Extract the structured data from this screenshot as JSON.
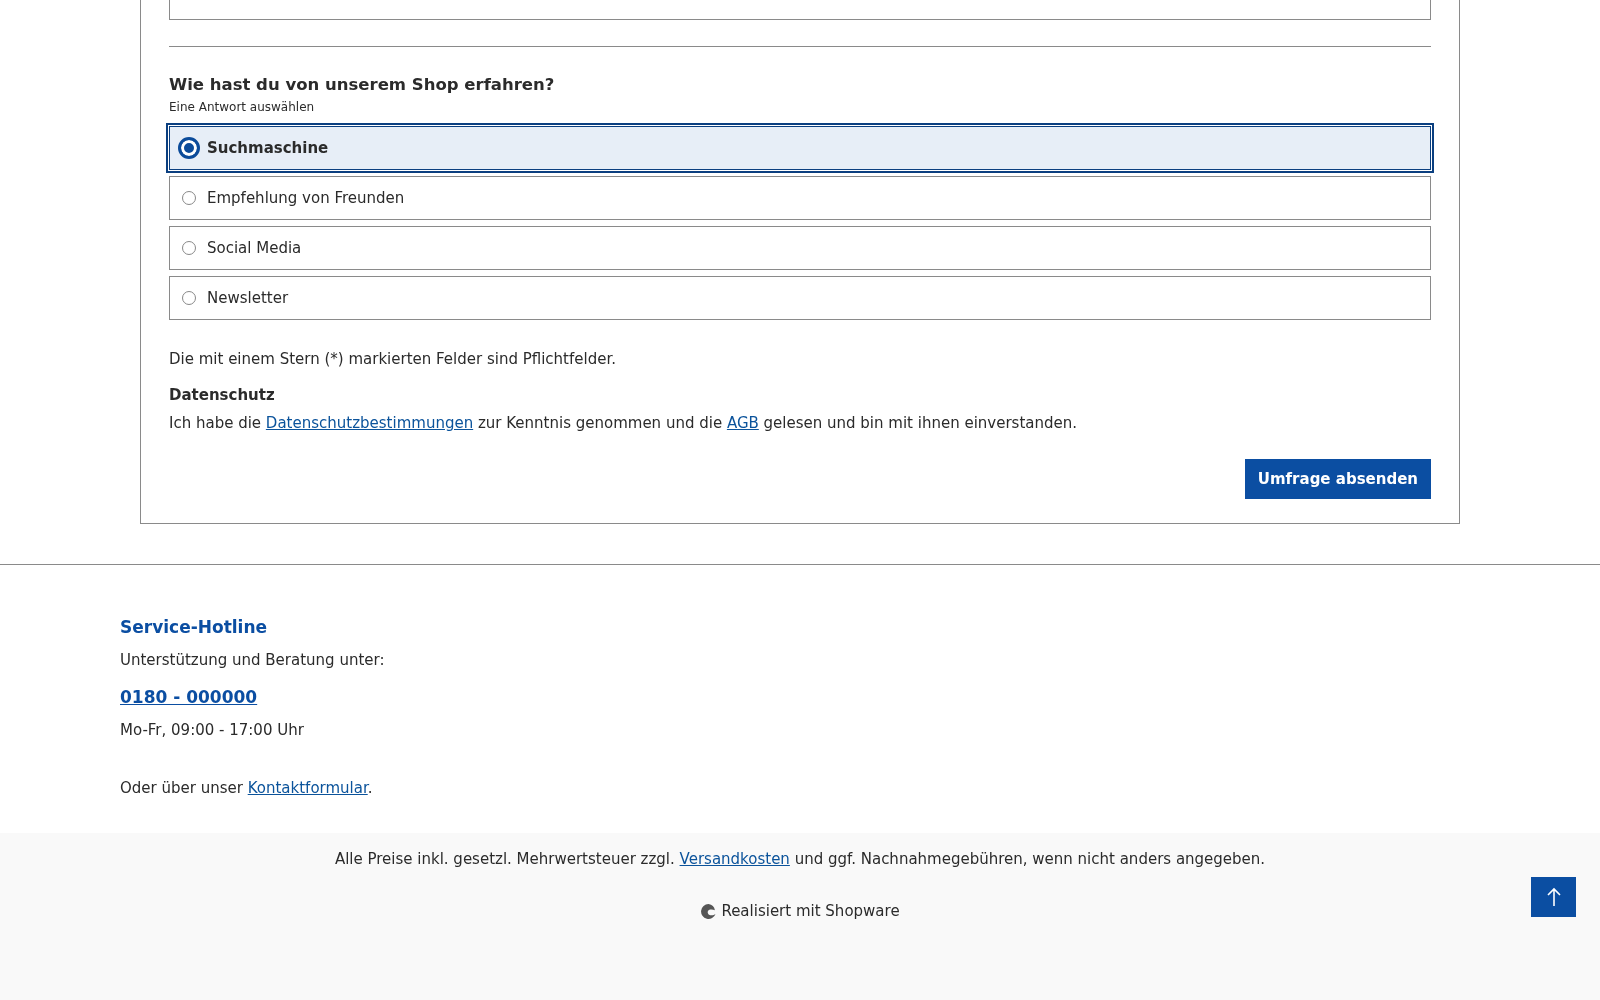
{
  "survey": {
    "question": "Wie hast du von unserem Shop erfahren?",
    "hint": "Eine Antwort auswählen",
    "options": [
      {
        "label": "Suchmaschine",
        "selected": true
      },
      {
        "label": "Empfehlung von Freunden",
        "selected": false
      },
      {
        "label": "Social Media",
        "selected": false
      },
      {
        "label": "Newsletter",
        "selected": false
      }
    ],
    "required_note": "Die mit einem Stern (*) markierten Felder sind Pflichtfelder.",
    "privacy_title": "Datenschutz",
    "privacy_text": [
      {
        "kind": "text",
        "text": "Ich habe die "
      },
      {
        "kind": "link",
        "text": "Datenschutzbestimmungen"
      },
      {
        "kind": "text",
        "text": " zur Kenntnis genommen und die "
      },
      {
        "kind": "link",
        "text": "AGB"
      },
      {
        "kind": "text",
        "text": " gelesen und bin mit ihnen einverstanden."
      }
    ],
    "submit": "Umfrage absenden"
  },
  "hotline": {
    "title": "Service-Hotline",
    "subtitle": "Unterstützung und Beratung unter:",
    "phone": "0180 - 000000",
    "hours": "Mo-Fr, 09:00 - 17:00 Uhr",
    "contact": [
      {
        "kind": "text",
        "text": "Oder über unser "
      },
      {
        "kind": "link",
        "text": "Kontaktformular"
      },
      {
        "kind": "text",
        "text": "."
      }
    ]
  },
  "footer": {
    "vat": [
      {
        "kind": "text",
        "text": "Alle Preise inkl. gesetzl. Mehrwertsteuer zzgl. "
      },
      {
        "kind": "link",
        "text": "Versandkosten"
      },
      {
        "kind": "text",
        "text": " und ggf. Nachnahmegebühren, wenn nicht anders angegeben."
      }
    ],
    "powered": "Realisiert mit Shopware"
  }
}
